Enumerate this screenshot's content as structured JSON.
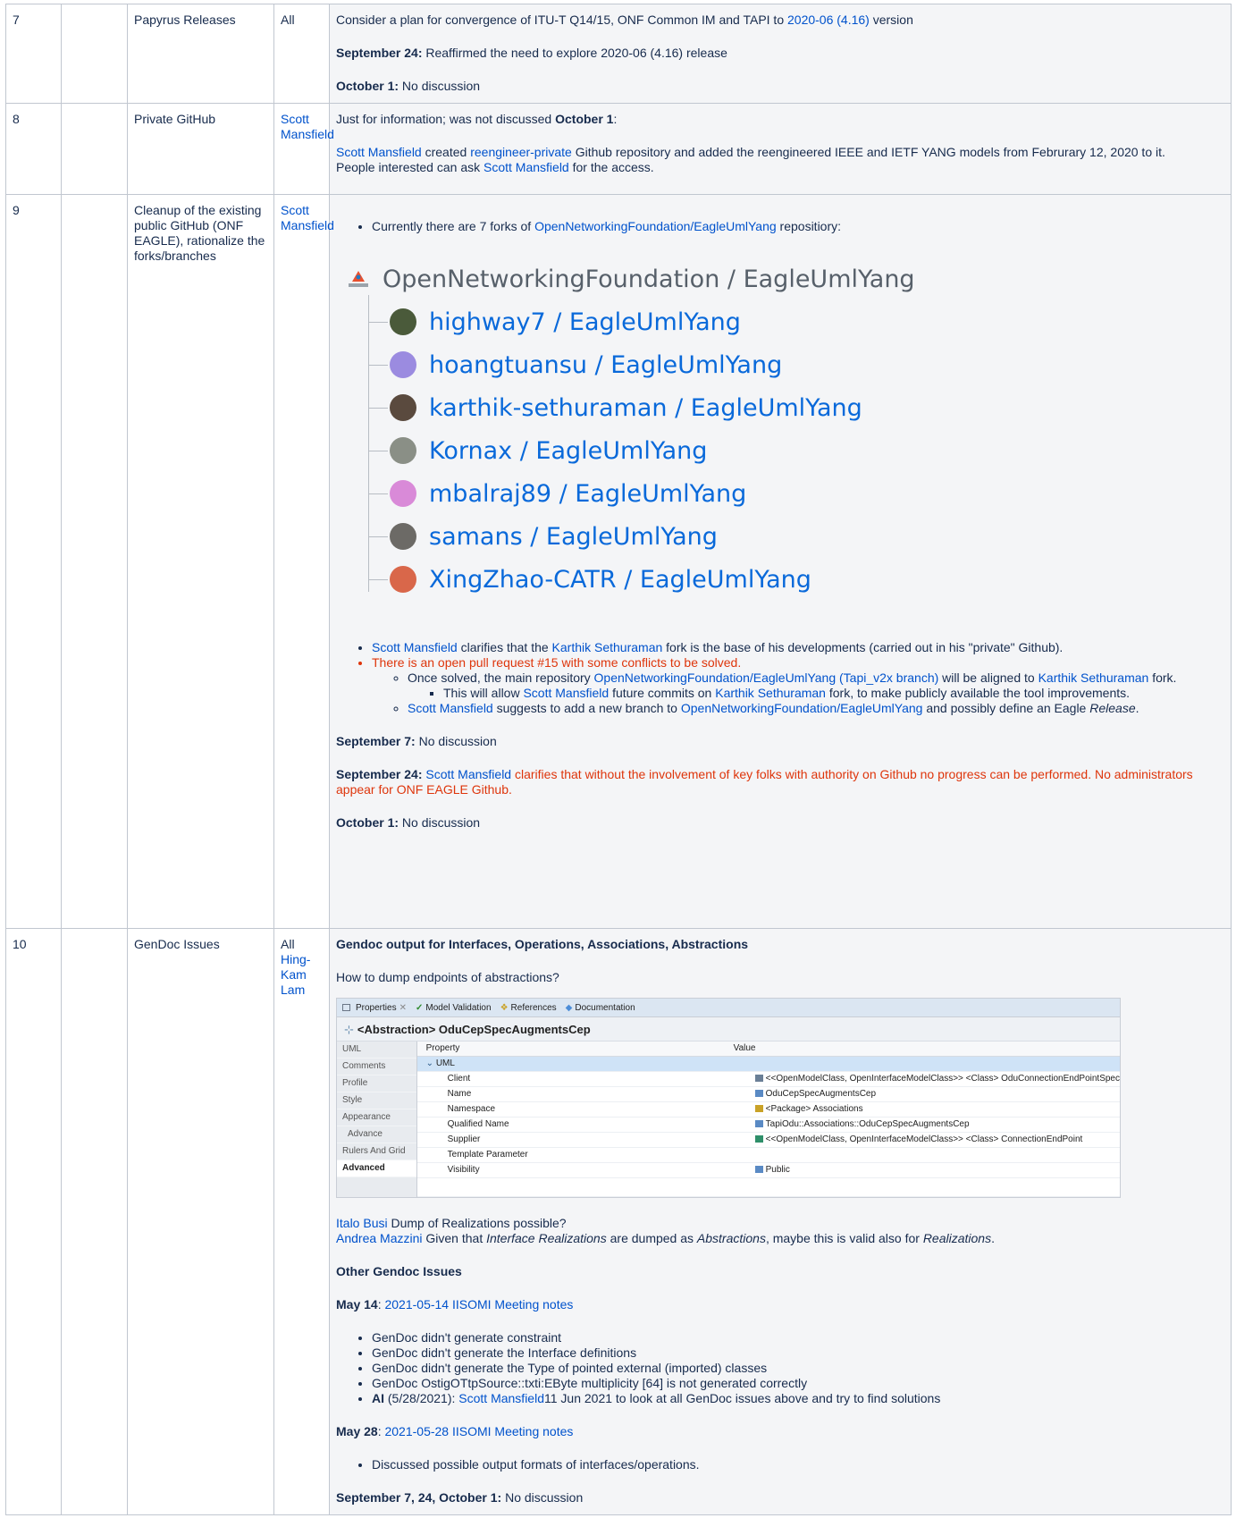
{
  "rows": [
    {
      "num": "7",
      "topic": "Papyrus Releases",
      "owner": "All",
      "intro_text": "Consider a plan for convergence of ITU-T Q14/15, ONF Common IM and TAPI to ",
      "intro_link": "2020-06 (4.16)",
      "intro_tail": " version",
      "sep24_label": "September 24:",
      "sep24_text": " Reaffirmed the need to explore 2020-06 (4.16) release",
      "oct1_label": "October 1:",
      "oct1_text": " No discussion"
    },
    {
      "num": "8",
      "topic": "Private GitHub",
      "owner": "Scott Mansfield",
      "p1_text": "Just for information; was not discussed ",
      "p1_bold": "October 1",
      "p1_tail": ":",
      "p2_link1": "Scott Mansfield",
      "p2_text1": " created ",
      "p2_link2": "reengineer-private",
      "p2_text2": " Github repository and added the reengineered IEEE and IETF YANG models from Februrary 12, 2020 to it.",
      "p2_text3": "People interested can ask ",
      "p2_link3": "Scott Mansfield",
      "p2_text4": " for the access."
    },
    {
      "num": "9",
      "topic": "Cleanup of the existing public GitHub (ONF EAGLE), rationalize the forks/branches",
      "owner": "Scott Mansfield",
      "b1_text": "Currently there are 7 forks of ",
      "b1_link": "OpenNetworkingFoundation/EagleUmlYang",
      "b1_tail": " repositiory:",
      "fork_root": "OpenNetworkingFoundation / EagleUmlYang",
      "forks": [
        {
          "user": "highway7",
          "repo": "EagleUmlYang",
          "color": "#4a5a3a"
        },
        {
          "user": "hoangtuansu",
          "repo": "EagleUmlYang",
          "color": "#9b8be0"
        },
        {
          "user": "karthik-sethuraman",
          "repo": "EagleUmlYang",
          "color": "#5a4a3e"
        },
        {
          "user": "Kornax",
          "repo": "EagleUmlYang",
          "color": "#8a8f86"
        },
        {
          "user": "mbalraj89",
          "repo": "EagleUmlYang",
          "color": "#d98ad8"
        },
        {
          "user": "samans",
          "repo": "EagleUmlYang",
          "color": "#6c6a66"
        },
        {
          "user": "XingZhao-CATR",
          "repo": "EagleUmlYang",
          "color": "#d9674a"
        }
      ],
      "c1_link1": "Scott Mansfield",
      "c1_text1": " clarifies that the ",
      "c1_link2": "Karthik Sethuraman",
      "c1_text2": " fork is the base of his developments (carried out in his \"private\" Github).",
      "c2_text": "There is an open pull request #15 with some conflicts to be solved.",
      "c2a_text1": "Once solved, the main repository ",
      "c2a_link1": "OpenNetworkingFoundation/EagleUmlYang (Tapi_v2x branch)",
      "c2a_text2": " will be aligned to ",
      "c2a_link2": "Karthik Sethuraman",
      "c2a_text3": " fork.",
      "c2a1_text1": "This will allow ",
      "c2a1_link1": "Scott Mansfield",
      "c2a1_text2": " future commits on ",
      "c2a1_link2": "Karthik Sethuraman",
      "c2a1_text3": " fork, to make publicly available the tool improvements.",
      "c2b_link1": "Scott Mansfield",
      "c2b_text1": " suggests to add a new branch to ",
      "c2b_link2": "OpenNetworkingFoundation/EagleUmlYang",
      "c2b_text2": " and possibly define an Eagle ",
      "c2b_italic": "Release",
      "c2b_tail": ".",
      "sep7_label": "September 7:",
      "sep7_text": " No discussion",
      "sep24_label": "September 24:",
      "sep24_link": "Scott Mansfield",
      "sep24_text": " clarifies that without the involvement of key folks with authority on Github no progress can be performed. No administrators appear for ONF EAGLE Github.",
      "oct1_label": "October 1:",
      "oct1_text": " No discussion"
    },
    {
      "num": "10",
      "topic": "GenDoc Issues",
      "owner_plain": "All",
      "owner_link": "Hing-Kam Lam",
      "heading1": "Gendoc output for Interfaces, Operations, Associations, Abstractions",
      "question": "How to dump endpoints of abstractions?",
      "props": {
        "tabs": [
          "Properties",
          "Model Validation",
          "References",
          "Documentation"
        ],
        "title": "<Abstraction> OduCepSpecAugmentsCep",
        "side": [
          "UML",
          "Comments",
          "Profile",
          "Style",
          "Appearance",
          "Advance",
          "Rulers And Grid",
          "Advanced"
        ],
        "col_property": "Property",
        "col_value": "Value",
        "group": "UML",
        "rows": [
          {
            "k": "Client",
            "v": "<<OpenModelClass, OpenInterfaceModelClass>> <Class> OduConnectionEndPointSpec"
          },
          {
            "k": "Name",
            "v": "OduCepSpecAugmentsCep"
          },
          {
            "k": "Namespace",
            "v": "<Package> Associations"
          },
          {
            "k": "Qualified Name",
            "v": "TapiOdu::Associations::OduCepSpecAugmentsCep"
          },
          {
            "k": "Supplier",
            "v": "<<OpenModelClass, OpenInterfaceModelClass>> <Class> ConnectionEndPoint"
          },
          {
            "k": "Template Parameter",
            "v": ""
          },
          {
            "k": "Visibility",
            "v": "Public"
          }
        ]
      },
      "q1_link": "Italo Busi",
      "q1_text": " Dump of Realizations possible?",
      "q2_link": "Andrea Mazzini",
      "q2_text1": " Given that ",
      "q2_it1": "Interface Realizations",
      "q2_text2": " are dumped as ",
      "q2_it2": "Abstractions",
      "q2_text3": ", maybe this is valid also for ",
      "q2_it3": "Realizations",
      "q2_tail": ".",
      "heading2": "Other Gendoc Issues",
      "may14_label": "May 14",
      "may14_colon": ": ",
      "may14_link": "2021-05-14 IISOMI Meeting notes",
      "issues": [
        "GenDoc didn't generate constraint",
        "GenDoc didn't generate the Interface definitions",
        "GenDoc didn't generate the Type of pointed external (imported) classes",
        "GenDoc OstigOTtpSource::txti:EByte multiplicity [64] is not generated correctly"
      ],
      "ai_label": "AI",
      "ai_text1": " (5/28/2021): ",
      "ai_link": "Scott Mansfield",
      "ai_text2": "11 Jun 2021 to look at all GenDoc issues above and try to find solutions",
      "may28_label": "May 28",
      "may28_colon": ":  ",
      "may28_link": "2021-05-28 IISOMI Meeting notes",
      "may28_item": "Discussed possible output formats of interfaces/operations.",
      "last_label": "September 7, 24, October 1:",
      "last_text": "  No discussion"
    }
  ]
}
